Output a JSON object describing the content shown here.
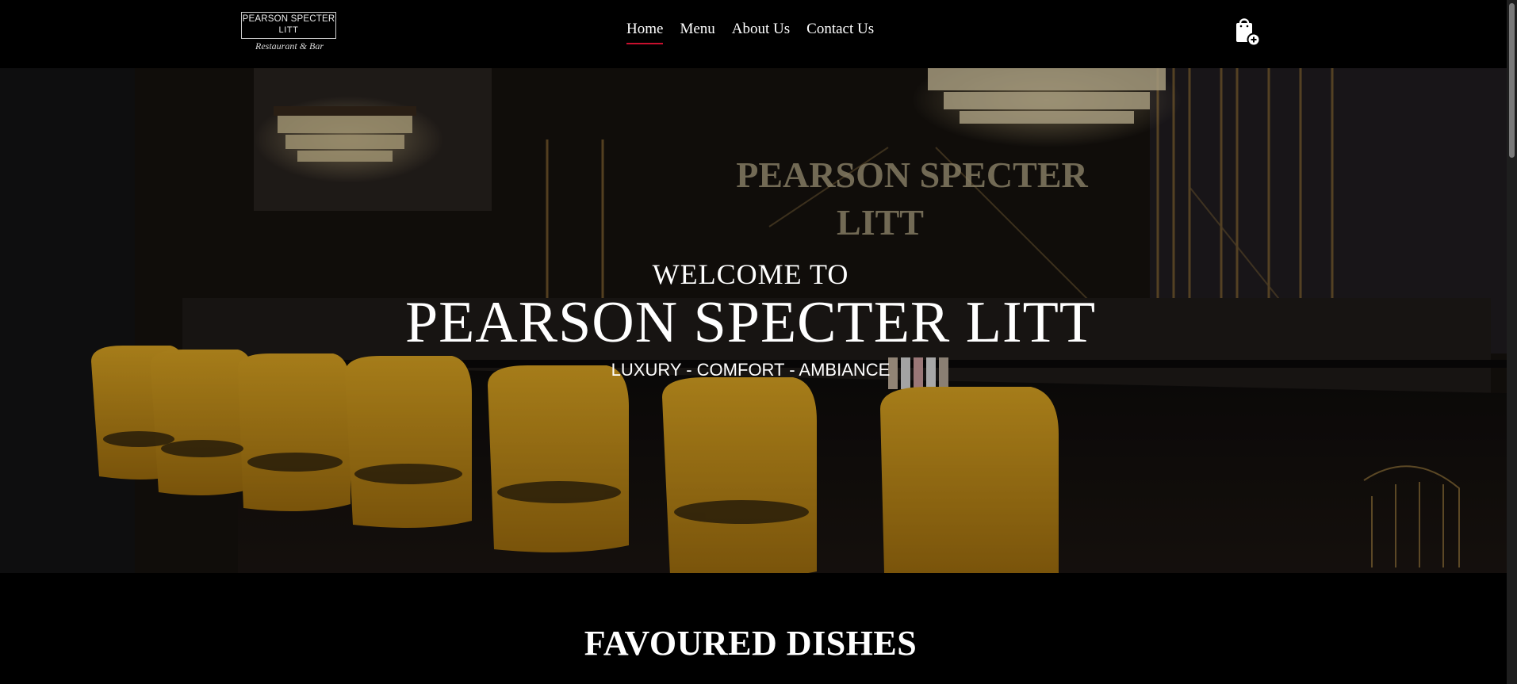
{
  "header": {
    "logo": {
      "line1": "PEARSON SPECTER",
      "line2": "LITT",
      "line3": "Restaurant & Bar"
    },
    "nav": [
      {
        "label": "Home",
        "active": true
      },
      {
        "label": "Menu",
        "active": false
      },
      {
        "label": "About Us",
        "active": false
      },
      {
        "label": "Contact Us",
        "active": false
      }
    ],
    "cart_icon": "shopping-bag-add-icon",
    "accent_color": "#c8102e"
  },
  "hero": {
    "welcome": "WELCOME TO",
    "title": "PEARSON SPECTER LITT",
    "tagline": "LUXURY - COMFORT - AMBIANCE",
    "image_sign_text": "PEARSON SPECTER LITT"
  },
  "sections": {
    "favoured_title": "FAVOURED DISHES"
  }
}
